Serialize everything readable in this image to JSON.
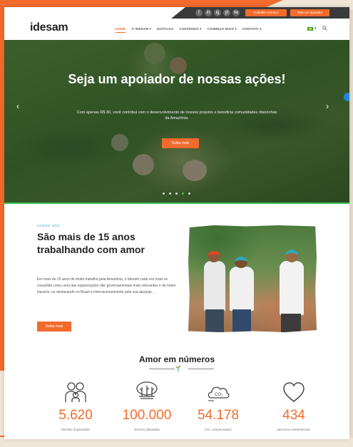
{
  "topbar": {
    "social": [
      "f",
      "in",
      "ig",
      "yt",
      "tw"
    ],
    "buttons": [
      "Trabalhe conosco",
      "Seja um apoiador"
    ]
  },
  "header": {
    "logo": "idesam",
    "nav": [
      "HOME",
      "O IDESAM ▾",
      "NOTÍCIAS",
      "CONTEÚDO ▾",
      "CONHEÇA MAIS ▾",
      "CONTATO ▾"
    ],
    "language": "▾"
  },
  "hero": {
    "title": "Seja um apoiador de nossas ações!",
    "subtitle": "Com apenas R$ 30, você contribui com o desenvolvimento de nossos projetos e beneficia comunidades ribeirinhas da Amazônia.",
    "button": "Saiba mais",
    "prev_arrow": "‹",
    "next_arrow": "›",
    "slide_count": 5,
    "active_slide": 4
  },
  "about": {
    "eyebrow": "SOBRE NÓS",
    "title": "São mais de 15 anos trabalhando com amor",
    "text": "Em mais de 15 anos de muito trabalho pela Amazônia, o Idesam cada vez mais se consolida como uma das organizações não governamentais mais relevantes e de maior impacto, se destacando no Brasil e internacionalmente pela sua atuação…",
    "button": "Saiba mais"
  },
  "numbers": {
    "title": "Amor em números",
    "stats": [
      {
        "icon": "family-icon",
        "value": "5.620",
        "label": "famílias impactadas"
      },
      {
        "icon": "trees-icon",
        "value": "100.000",
        "label": "árvores plantadas"
      },
      {
        "icon": "co2-cloud-icon",
        "value": "54.178",
        "label": "CO₂ compensados",
        "icon_text": "CO₂"
      },
      {
        "icon": "heart-icon",
        "value": "434",
        "label": "parceiros estabelecidos"
      }
    ]
  },
  "colors": {
    "accent": "#f26b2d",
    "green": "#3fbf5a",
    "eyebrow": "#3fa6c9"
  }
}
